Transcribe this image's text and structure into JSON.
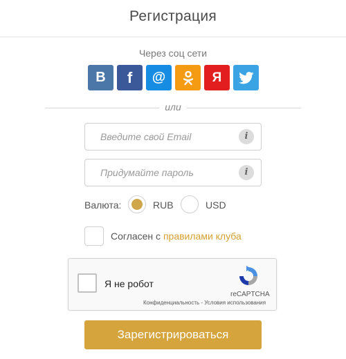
{
  "header": {
    "title": "Регистрация"
  },
  "social": {
    "caption": "Через соц сети",
    "buttons": [
      {
        "network": "vkontakte",
        "label": "B",
        "color": "#4a76a8"
      },
      {
        "network": "facebook",
        "label": "f",
        "color": "#3b5998"
      },
      {
        "network": "mail-ru",
        "label": "@",
        "color": "#168de2"
      },
      {
        "network": "odnoklassniki",
        "label": "",
        "icon": "odnoklassniki-icon",
        "color": "#f59a13"
      },
      {
        "network": "yandex",
        "label": "Я",
        "color": "#e31e1e"
      },
      {
        "network": "twitter",
        "label": "",
        "icon": "twitter-bird-icon",
        "color": "#3aa3e3"
      }
    ]
  },
  "divider": {
    "text": "или"
  },
  "form": {
    "email_placeholder": "Введите свой Email",
    "password_placeholder": "Придумайте пароль",
    "info_icon_glyph": "i",
    "currency_label": "Валюта:",
    "currency_options": [
      {
        "label": "RUB",
        "selected": true
      },
      {
        "label": "USD",
        "selected": false
      }
    ],
    "agree_prefix": "Согласен с ",
    "agree_link": "правилами клуба",
    "submit_label": "Зарегистрироваться"
  },
  "recaptcha": {
    "label": "Я не робот",
    "brand": "reCAPTCHA",
    "terms": "Конфиденциальность - Условия использования"
  },
  "colors": {
    "accent": "#d6a43c",
    "link": "#d6a132",
    "radio_selected": "#cfa64a"
  }
}
